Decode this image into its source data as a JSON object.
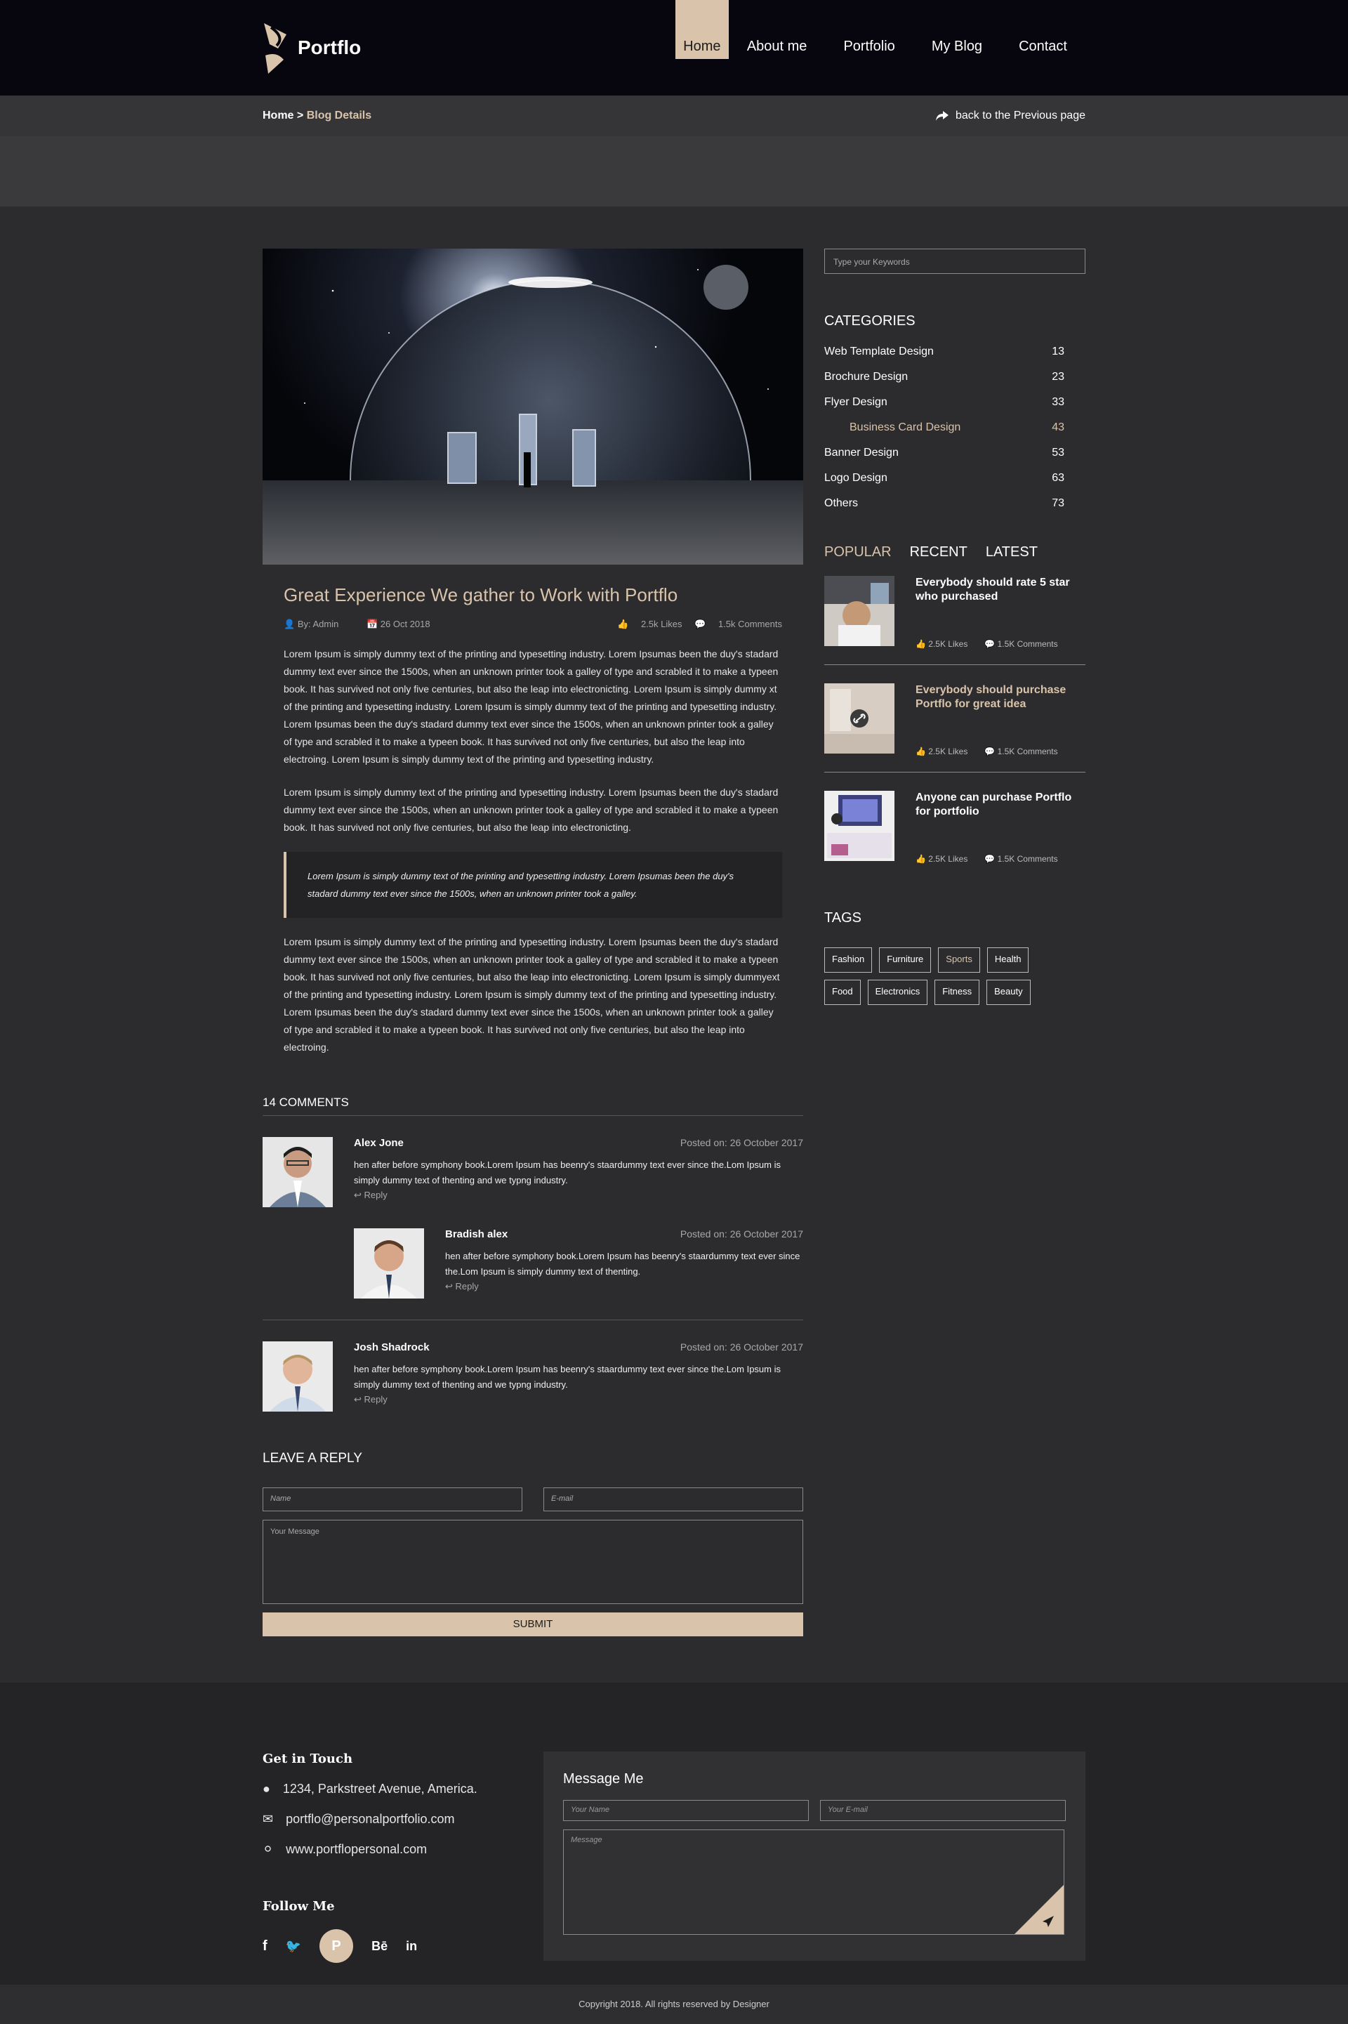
{
  "brand": {
    "name": "Portflo"
  },
  "nav": [
    "Home",
    "About me",
    "Portfolio",
    "My Blog",
    "Contact"
  ],
  "breadcrumb": {
    "home": "Home",
    "separator": " > ",
    "current": "Blog Details",
    "back": "back to the Previous page"
  },
  "post": {
    "title": "Great Experience We gather to Work with Portflo",
    "author": "By: Admin",
    "date": "26 Oct 2018",
    "likes": "2.5k Likes",
    "comments": "1.5k Comments",
    "p1": "Lorem Ipsum is simply dummy text of the printing and typesetting industry. Lorem Ipsumas been the duy's stadard dummy text ever since the 1500s, when an unknown printer took a galley of type and scrabled it to make a typeen book. It has survived not only five centuries, but also the leap into electronicting. Lorem Ipsum is simply dummy xt of the printing and typesetting industry. Lorem Ipsum is simply dummy text of the printing and typesetting industry. Lorem Ipsumas been the duy's stadard dummy text ever since the 1500s, when an unknown printer took a galley of type and scrabled it to make a typeen book. It has survived not only five centuries, but also the leap into electroing. Lorem Ipsum is simply dummy text of the printing and typesetting industry.",
    "p2": "Lorem Ipsum is simply dummy text of the printing and typesetting industry. Lorem Ipsumas been the duy's stadard dummy text ever since the 1500s, when an unknown printer took a galley of type and scrabled it to make a typeen book. It has survived not only five centuries, but also the leap into electronicting.",
    "quote": "Lorem Ipsum is simply dummy text of the printing and typesetting industry. Lorem Ipsumas been the duy's stadard dummy text ever since the 1500s, when an unknown printer took a galley.",
    "p3": "Lorem Ipsum is simply dummy text of the printing and typesetting industry. Lorem Ipsumas been the duy's stadard dummy text ever since the 1500s, when an unknown printer took a galley of type and scrabled it to make a typeen book. It has survived not only five centuries, but also the leap into electronicting. Lorem Ipsum is simply dummyext of the printing and typesetting industry. Lorem Ipsum is simply dummy text of the printing and typesetting industry. Lorem Ipsumas been the duy's stadard dummy text ever since the 1500s, when an unknown printer took a galley of type and scrabled it to make a typeen book. It has survived not only five centuries, but also the leap into electroing."
  },
  "comments": {
    "title": "14 COMMENTS",
    "items": [
      {
        "name": "Alex Jone",
        "date": "Posted on: 26 October 2017",
        "text": "hen after before symphony book.Lorem Ipsum has beenry's staardummy text ever since the.Lom Ipsum is simply dummy text of thenting  and we typng industry.",
        "reply": "Reply"
      },
      {
        "name": "Bradish alex",
        "date": "Posted on: 26 October 2017",
        "text": "hen after before symphony book.Lorem Ipsum has beenry's staardummy text ever since the.Lom Ipsum is simply dummy text of thenting.",
        "reply": "Reply"
      },
      {
        "name": "Josh Shadrock",
        "date": "Posted on: 26 October 2017",
        "text": "hen after before symphony book.Lorem Ipsum has beenry's staardummy text ever since the.Lom Ipsum is simply dummy text of thenting  and we typng industry.",
        "reply": "Reply"
      }
    ]
  },
  "reply_form": {
    "title": "LEAVE A REPLY",
    "name": "Name",
    "email": "E-mail",
    "message": "Your Message",
    "submit": "SUBMIT"
  },
  "sidebar": {
    "search": "Type your Keywords",
    "categories_title": "CATEGORIES",
    "categories": [
      {
        "label": "Web Template Design",
        "count": "13"
      },
      {
        "label": "Brochure Design",
        "count": "23"
      },
      {
        "label": "Flyer Design",
        "count": "33"
      },
      {
        "label": "Business Card Design",
        "count": "43"
      },
      {
        "label": "Banner Design",
        "count": "53"
      },
      {
        "label": "Logo Design",
        "count": "63"
      },
      {
        "label": "Others",
        "count": "73"
      }
    ],
    "tabs": [
      "POPULAR",
      "RECENT",
      "LATEST"
    ],
    "posts": [
      {
        "title": "Everybody should rate 5 star who purchased",
        "likes": "2.5K Likes",
        "comments": "1.5K Comments"
      },
      {
        "title": "Everybody should purchase Portflo for great idea",
        "likes": "2.5K Likes",
        "comments": "1.5K Comments"
      },
      {
        "title": "Anyone can purchase Portflo for portfolio",
        "likes": "2.5K Likes",
        "comments": "1.5K Comments"
      }
    ],
    "tags_title": "TAGS",
    "tags": [
      "Fashion",
      "Furniture",
      "Sports",
      "Health",
      "Food",
      "Electronics",
      "Fitness",
      "Beauty"
    ]
  },
  "footer": {
    "touch_title": "Get in Touch",
    "address": "1234, Parkstreet Avenue, America.",
    "email": "portflo@personalportfolio.com",
    "web": "www.portflopersonal.com",
    "follow_title": "Follow Me",
    "message_title": "Message Me",
    "name_ph": "Your Name",
    "email_ph": "Your E-mail",
    "message_ph": "Message",
    "copyright": "Copyright 2018. All rights reserved by Designer"
  },
  "colors": {
    "accent": "#d9c3aa",
    "header": "#07050e",
    "body": "#2c2c2e"
  }
}
